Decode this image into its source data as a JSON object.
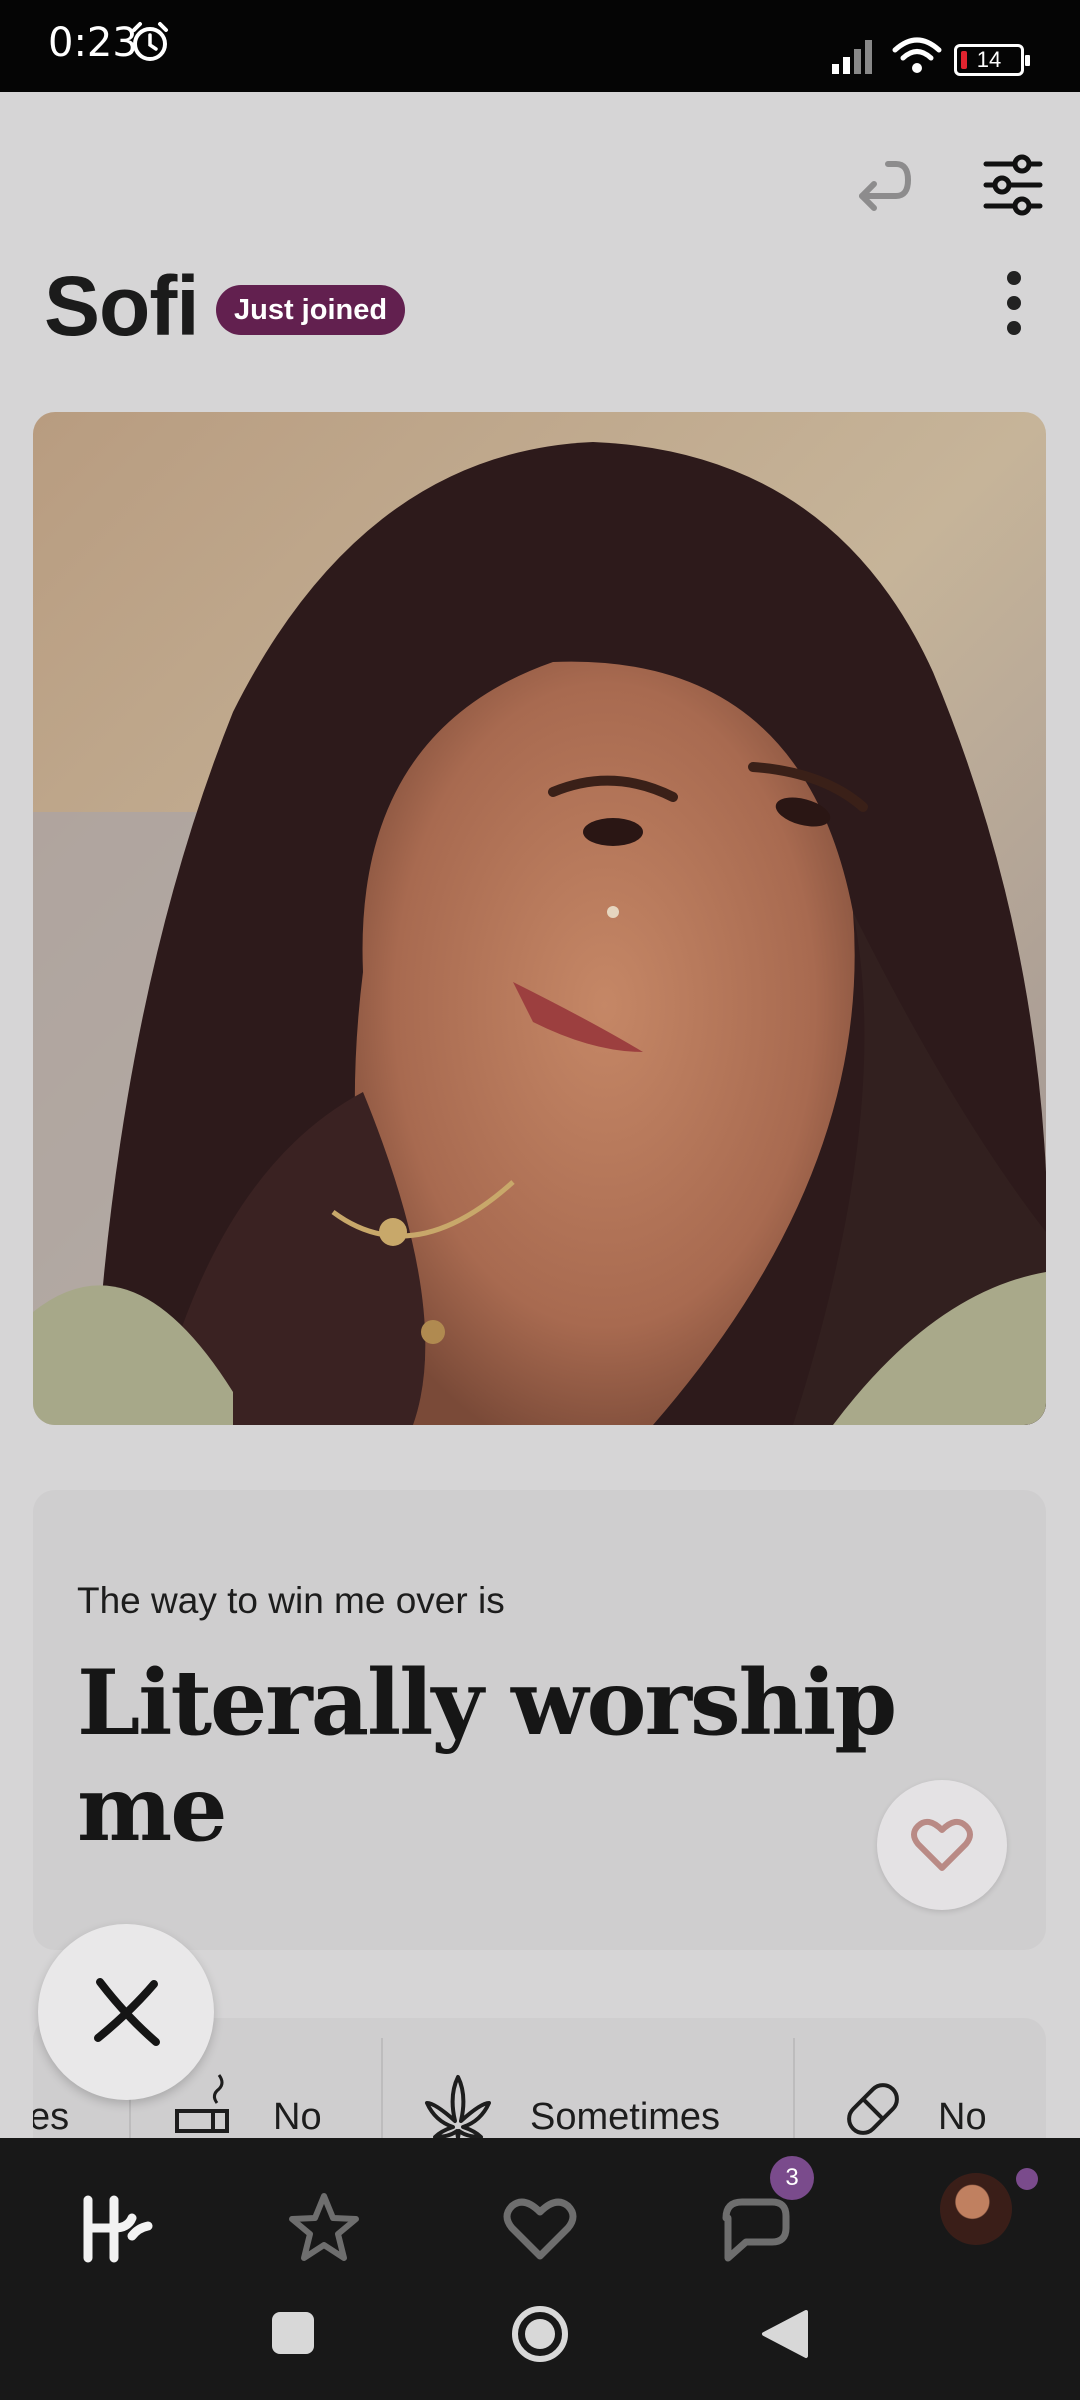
{
  "status_bar": {
    "time": "0:23",
    "battery": "14",
    "icons": [
      "alarm-icon",
      "signal-icon",
      "wifi-icon",
      "battery-icon"
    ]
  },
  "header": {
    "icons": [
      "undo-icon",
      "filter-sliders-icon",
      "more-vertical-icon"
    ]
  },
  "profile": {
    "name": "Sofi",
    "badge": "Just joined"
  },
  "prompt": {
    "question": "The way to win me over is",
    "answer": "Literally worship me"
  },
  "vitals": [
    {
      "icon": "partial-item",
      "label": "es"
    },
    {
      "icon": "cigarette-icon",
      "label": "No"
    },
    {
      "icon": "cannabis-leaf-icon",
      "label": "Sometimes"
    },
    {
      "icon": "pill-icon",
      "label": "No"
    }
  ],
  "tabbar": {
    "items": [
      "home-logo-icon",
      "star-icon",
      "heart-icon",
      "chat-icon",
      "profile-avatar"
    ],
    "chat_badge": "3"
  },
  "colors": {
    "background": "#d6d5d6",
    "badge": "#62204f",
    "tabbar": "#181818",
    "accent": "#7a4b8c"
  }
}
